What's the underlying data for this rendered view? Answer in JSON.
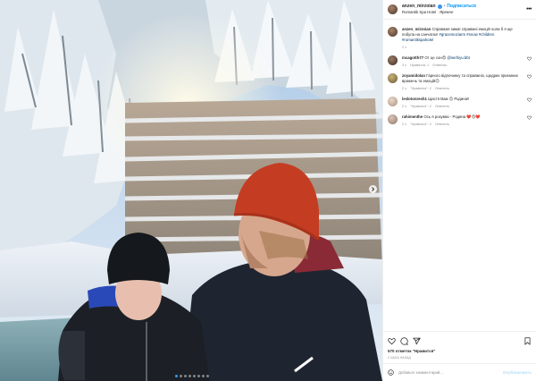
{
  "post": {
    "username": "anzen_mirzoian",
    "follow_label": "Подписаться",
    "separator": "•",
    "location": "Romantik Spa Hotel · Яремче",
    "caption": {
      "username": "anzen_mirzoian",
      "text": "Справжня зима! справжні емоції! коли б я ще побула на санчатах!",
      "hashtags": "#gracemoziarm #snow #children #romantikspahotel",
      "time": "2 ч"
    },
    "comments": [
      {
        "username": "mcagotth77",
        "text": "От це сон😍",
        "mention": "@serhiyu.bbt",
        "time": "3 ч",
        "likes": "Нравится: 1",
        "reply": "Ответить"
      },
      {
        "username": "zoyamidolan",
        "text": "Гарного відпочинку та справжніх, щедрих приємних вражень та емоцій😊",
        "mention": "",
        "time": "2 ч",
        "likes": "\"Нравится\": 2",
        "reply": "Ответить"
      },
      {
        "username": "leslotonresh1",
        "text": "Щастя Вам 😊 Родина!!",
        "mention": "",
        "time": "2 ч",
        "likes": "\"Нравится\": 2",
        "reply": "Ответить"
      },
      {
        "username": "rahimenthe",
        "text": "Ось я розумію - Родина ❤️😍❤️",
        "mention": "",
        "time": "2 ч",
        "likes": "\"Нравится\": 2",
        "reply": "Ответить"
      }
    ],
    "likes_text": "570 отметок \"Нравится\"",
    "date_text": "2 часа назад",
    "add_comment_placeholder": "Добавьте комментарий...",
    "publish_label": "Опубликовать",
    "more_icon": "more-horizontal-icon",
    "icons": [
      "heart-icon",
      "comment-icon",
      "share-icon",
      "bookmark-icon",
      "emoji-icon",
      "verified-badge-icon",
      "chevron-right-icon"
    ]
  },
  "carousel": {
    "count": 8,
    "active_index": 0
  },
  "colors": {
    "link_blue": "#0095f6",
    "hashtag_blue": "#00376b",
    "muted_text": "#8e8e8e",
    "border": "#efefef",
    "active_dot": "#3797f0"
  }
}
